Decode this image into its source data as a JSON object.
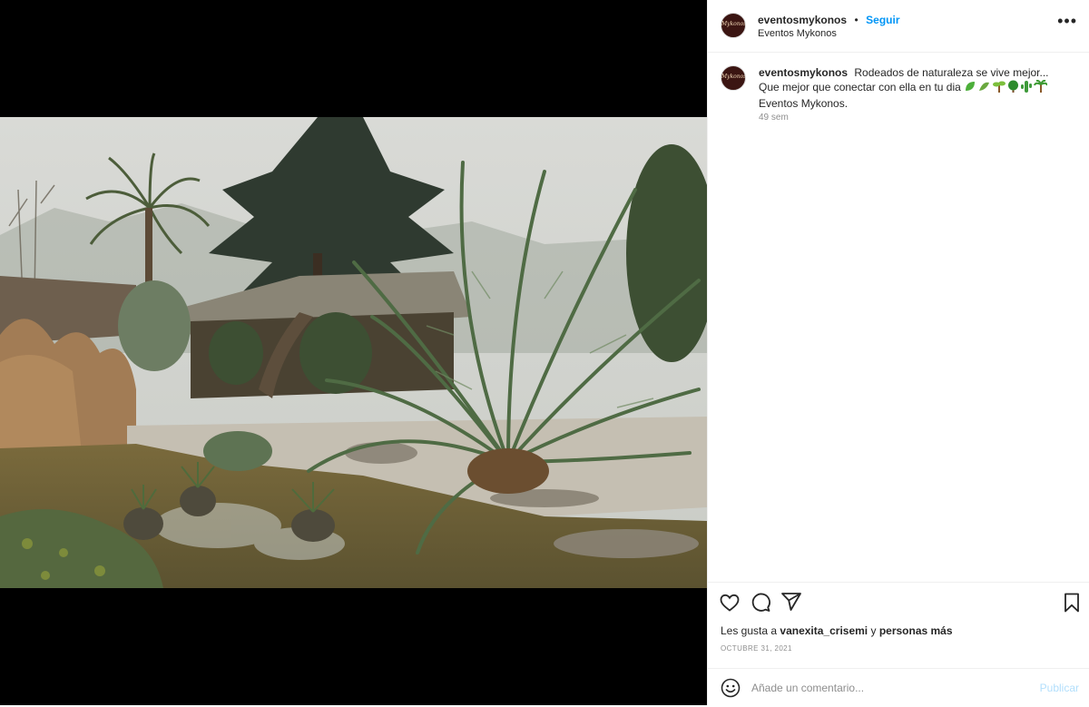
{
  "post": {
    "username": "eventosmykonos",
    "dot": "•",
    "follow_label": "Seguir",
    "location": "Eventos Mykonos",
    "avatar_text": "Mykonos",
    "more_label": "•••",
    "caption_text": "Rodeados de naturaleza se vive mejor... Que mejor que conectar con ella en tu dia",
    "caption_emojis": [
      "leaf-icon",
      "herb-icon",
      "seedling-icon",
      "tree-icon",
      "cactus-icon",
      "palm-icon"
    ],
    "caption_suffix": "Eventos Mykonos.",
    "time_ago": "49 sem",
    "likes_prefix": "Les gusta a",
    "likes_user": "vanexita_crisemi",
    "likes_and": "y",
    "likes_others": "personas más",
    "date": "OCTUBRE 31, 2021",
    "comment_placeholder": "Añade un comentario...",
    "publish_label": "Publicar"
  },
  "colors": {
    "accent": "#0095f6",
    "publish_disabled": "#b2dffc",
    "muted": "#8e8e8e",
    "text": "#262626"
  }
}
